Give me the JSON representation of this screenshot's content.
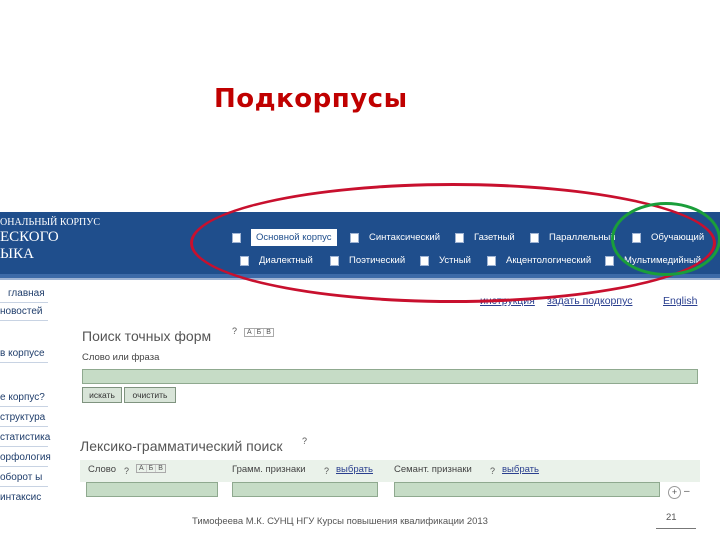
{
  "slide": {
    "title": "Подкорпусы",
    "footer": "Тимофеева М.К. СУНЦ НГУ Курсы повышения квалификации 2013",
    "page_number": "21"
  },
  "site": {
    "logo": [
      "ОНАЛЬНЫЙ КОРПУС",
      "ЕСКОГО",
      "ЫКА"
    ],
    "nav_row1": [
      {
        "label": "Основной корпус",
        "active": true
      },
      {
        "label": "Синтаксический"
      },
      {
        "label": "Газетный"
      },
      {
        "label": "Параллельный"
      },
      {
        "label": "Обучающий"
      }
    ],
    "nav_row2": [
      {
        "label": "Диалектный"
      },
      {
        "label": "Поэтический"
      },
      {
        "label": "Устный"
      },
      {
        "label": "Акцентологический"
      },
      {
        "label": "Мультимедийный"
      }
    ],
    "sidebar": [
      "главная",
      "новостей",
      "в корпусе",
      "е корпус?",
      "структура",
      "статистика",
      "орфология",
      "оборот ы",
      "интаксис"
    ],
    "top_links": {
      "instruction": "инструкция",
      "set_subcorpus": "задать подкорпус",
      "english": "English"
    }
  },
  "exact_search": {
    "title": "Поиск точных форм",
    "help": "?",
    "kbd": [
      "А",
      "Б",
      "В"
    ],
    "field_label": "Слово или фраза",
    "search_button": "искать",
    "clear_button": "очистить"
  },
  "lexgram_search": {
    "title": "Лексико-грамматический поиск",
    "help": "?",
    "word_label": "Слово",
    "word_help": "?",
    "kbd": [
      "А",
      "Б",
      "В"
    ],
    "gram_label": "Грамм. признаки",
    "gram_help": "?",
    "gram_choose": "выбрать",
    "sem_label": "Семант. признаки",
    "sem_help": "?",
    "sem_choose": "выбрать"
  },
  "colors": {
    "title_red": "#c00000",
    "header_blue": "#1f4e8c",
    "field_green": "#c6dcc6",
    "oval_red": "#c8102e",
    "oval_green": "#1a9e3a"
  }
}
